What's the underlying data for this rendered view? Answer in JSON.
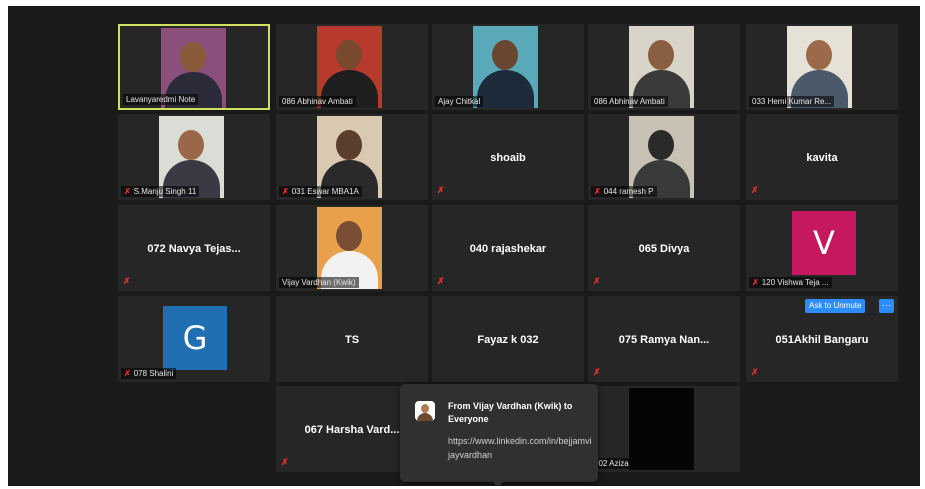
{
  "window": {
    "background": "#1a1a1a"
  },
  "tiles": [
    {
      "kind": "video",
      "name": "Lavanyaredmi Note",
      "muted": false,
      "active": true,
      "bg": "#8a4f7a",
      "skin": "#8a5a3a",
      "shirt": "#2b2b3a"
    },
    {
      "kind": "video",
      "name": "086 Abhinav Ambati",
      "muted": false,
      "bg": "#b83a2e",
      "skin": "#7a4a2e",
      "shirt": "#1f1f1f"
    },
    {
      "kind": "video",
      "name": "Ajay Chitkal",
      "muted": false,
      "bg": "#5aa9b8",
      "skin": "#6a4632",
      "shirt": "#1c2a3a"
    },
    {
      "kind": "video",
      "name": "086 Abhinav Ambati",
      "muted": false,
      "bg": "#d9d4c8",
      "skin": "#8a5e40",
      "shirt": "#3a3a3a"
    },
    {
      "kind": "video",
      "name": "033 Hemi Kumar Re...",
      "muted": false,
      "bg": "#e6e1d6",
      "skin": "#9a6a4a",
      "shirt": "#4a5a6a"
    },
    {
      "kind": "video",
      "name": "S.Manju Singh 11",
      "muted": true,
      "bg": "#dcdcd6",
      "skin": "#9a6848",
      "shirt": "#3a3a44"
    },
    {
      "kind": "video",
      "name": "031 Eswar MBA1A",
      "muted": true,
      "bg": "#d8c9b0",
      "skin": "#5a3e2e",
      "shirt": "#2a2a2a"
    },
    {
      "kind": "name",
      "name": "shoaib",
      "muted": true
    },
    {
      "kind": "video",
      "name": "044 ramesh P",
      "muted": true,
      "bg": "#c8c2b4",
      "skin": "#2a2a2a",
      "shirt": "#3a3a3a"
    },
    {
      "kind": "name",
      "name": "kavita",
      "muted": true
    },
    {
      "kind": "name",
      "name": "072 Navya Tejas...",
      "muted": true
    },
    {
      "kind": "video",
      "name": "Vijay Vardhan (Kwik)",
      "muted": false,
      "bg": "#e8a04a",
      "skin": "#7a4e34",
      "shirt": "#f2f2f2"
    },
    {
      "kind": "name",
      "name": "040 rajashekar",
      "muted": true
    },
    {
      "kind": "name",
      "name": "065 Divya",
      "muted": true
    },
    {
      "kind": "avatar",
      "letter": "V",
      "avatar_color": "#c6185e",
      "name": "120 Vishwa Teja ...",
      "muted": true
    },
    {
      "kind": "avatar",
      "letter": "G",
      "avatar_color": "#1f6fb2",
      "name": "078 Shalini",
      "muted": true
    },
    {
      "kind": "name",
      "name": "TS",
      "muted": false
    },
    {
      "kind": "name",
      "name": "Fayaz k 032",
      "muted": false
    },
    {
      "kind": "name",
      "name": "075 Ramya Nan...",
      "muted": true
    },
    {
      "kind": "name",
      "name": "051Akhil Bangaru",
      "muted": true,
      "ask_unmute": "Ask to Unmute",
      "more": "···"
    },
    {
      "kind": "name",
      "name": "067 Harsha Vard...",
      "muted": true
    },
    {
      "kind": "video",
      "name": "002 Aziza",
      "muted": false,
      "bg": "#050505",
      "noPerson": true
    }
  ],
  "chat": {
    "header": "From Vijay Vardhan (Kwik) to Everyone",
    "message": "https://www.linkedin.com/in/bejjamvijayvardhan"
  },
  "icons": {
    "muted_mic": "mic-muted-icon"
  }
}
